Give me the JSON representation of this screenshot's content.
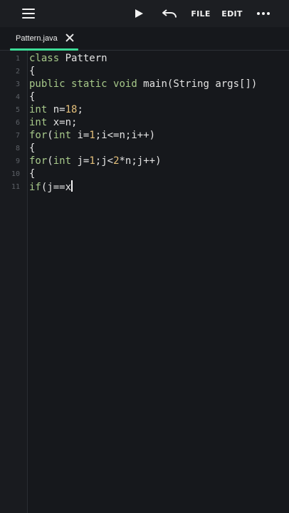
{
  "toolbar": {
    "menu_icon": "hamburger-icon",
    "run_icon": "play-icon",
    "undo_icon": "undo-icon",
    "file_label": "FILE",
    "edit_label": "EDIT",
    "more_icon": "more-dots-icon"
  },
  "tab": {
    "filename": "Pattern.java",
    "close_icon": "close-icon",
    "accent_color": "#3ddc97"
  },
  "editor": {
    "line_numbers": [
      "1",
      "2",
      "3",
      "4",
      "5",
      "6",
      "7",
      "8",
      "9",
      "10",
      "11"
    ],
    "lines": [
      "class Pattern",
      "{",
      "public static void main(String args[])",
      "{",
      "int n=18;",
      "int x=n;",
      "for(int i=1;i<=n;i++)",
      "{",
      "for(int j=1;j<2*n;j++)",
      "{",
      "if(j==x"
    ]
  },
  "colors": {
    "background": "#16181c",
    "keyword": "#a7c98a",
    "number": "#e5c07b",
    "text": "#e3e3e3"
  }
}
